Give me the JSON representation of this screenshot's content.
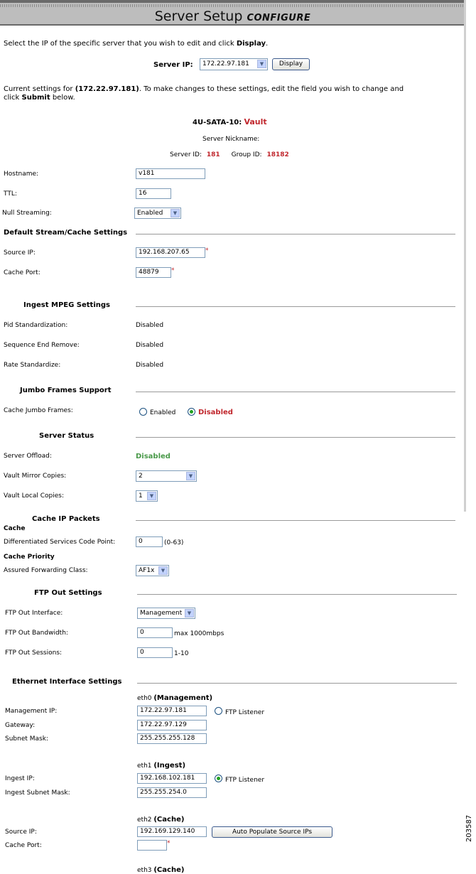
{
  "header": {
    "title": "Server Setup",
    "subtitle": "CONFIGURE"
  },
  "intro": {
    "text": "Select the IP of the specific server that you wish to edit and click ",
    "bold": "Display",
    "end": "."
  },
  "server_ip": {
    "label": "Server IP:",
    "value": "172.22.97.181",
    "button": "Display"
  },
  "current": {
    "prefix": "Current settings for ",
    "ip": "(172.22.97.181)",
    "suffix": ". To make changes to these settings, edit the field you wish to change and",
    "line2_prefix": "click ",
    "line2_bold": "Submit",
    "line2_suffix": " below."
  },
  "server": {
    "model": "4U-SATA-10:",
    "type": "Vault",
    "nickname_label": "Server Nickname:",
    "id_label": "Server ID:",
    "id": "181",
    "group_label": "Group ID:",
    "group": "18182"
  },
  "fields": {
    "hostname_label": "Hostname:",
    "hostname": "v181",
    "ttl_label": "TTL:",
    "ttl": "16",
    "null_label": "Null Streaming:",
    "null_value": "Enabled"
  },
  "default_stream": {
    "heading": "Default Stream/Cache Settings",
    "source_label": "Source IP:",
    "source": "192.168.207.65",
    "port_label": "Cache Port:",
    "port": "48879"
  },
  "ingest": {
    "heading": "Ingest MPEG Settings",
    "rows": [
      {
        "label": "Pid Standardization:",
        "value": "Disabled"
      },
      {
        "label": "Sequence End Remove:",
        "value": "Disabled"
      },
      {
        "label": "Rate Standardize:",
        "value": "Disabled"
      }
    ]
  },
  "jumbo": {
    "heading": "Jumbo Frames Support",
    "label": "Cache Jumbo Frames:",
    "opt1": "Enabled",
    "opt2": "Disabled"
  },
  "status": {
    "heading": "Server Status",
    "offload_label": "Server Offload:",
    "offload": "Disabled",
    "mirror_label": "Vault Mirror Copies:",
    "mirror": "2",
    "local_label": "Vault Local Copies:",
    "local": "1"
  },
  "cache_ip": {
    "heading": "Cache IP Packets",
    "sub1": "Cache",
    "dscp_label": "Differentiated Services Code Point:",
    "dscp": "0",
    "dscp_range": "(0-63)",
    "sub2": "Cache Priority",
    "af_label": "Assured Forwarding Class:",
    "af": "AF1x"
  },
  "ftp": {
    "heading": "FTP Out Settings",
    "iface_label": "FTP Out Interface:",
    "iface": "Management",
    "bw_label": "FTP Out Bandwidth:",
    "bw": "0",
    "bw_unit": "max 1000mbps",
    "sess_label": "FTP Out Sessions:",
    "sess": "0",
    "sess_range": "1-10"
  },
  "eth": {
    "heading": "Ethernet Interface Settings",
    "eth0": {
      "name": "eth0 ",
      "role": "(Management)",
      "ip_label": "Management IP:",
      "ip": "172.22.97.181",
      "ftp": "FTP Listener",
      "gw_label": "Gateway:",
      "gw": "172.22.97.129",
      "mask_label": "Subnet Mask:",
      "mask": "255.255.255.128"
    },
    "eth1": {
      "name": "eth1 ",
      "role": "(Ingest)",
      "ip_label": "Ingest IP:",
      "ip": "192.168.102.181",
      "ftp": "FTP Listener",
      "mask_label": "Ingest Subnet Mask:",
      "mask": "255.255.254.0"
    },
    "eth2": {
      "name": "eth2 ",
      "role": "(Cache)",
      "ip_label": "Source IP:",
      "ip": "192.169.129.140",
      "button": "Auto Populate Source IPs",
      "port_label": "Cache Port:",
      "port": ""
    },
    "eth3": {
      "name": "eth3 ",
      "role": "(Cache)"
    }
  },
  "figure_id": "203587"
}
